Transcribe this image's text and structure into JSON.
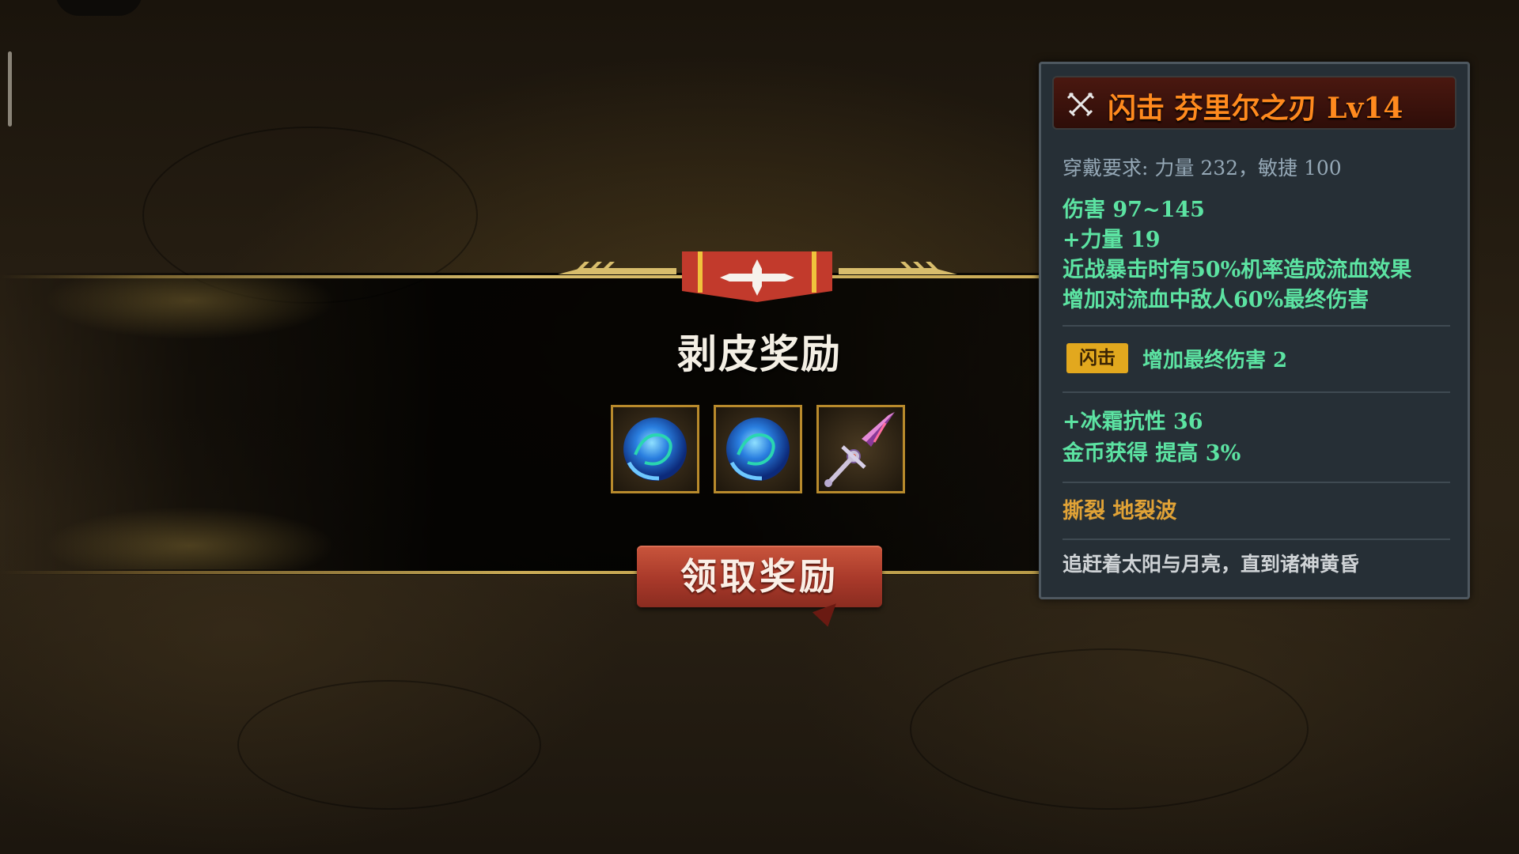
{
  "reward_dialog": {
    "title": "剥皮奖励",
    "rewards": [
      {
        "icon": "blue-orb-icon"
      },
      {
        "icon": "blue-orb-icon"
      },
      {
        "icon": "sword-icon"
      }
    ],
    "claim_button": "领取奖励"
  },
  "item_tooltip": {
    "header_icon": "crossed-swords-icon",
    "name": "闪击 芬里尔之刃 Lv14",
    "requirement": "穿戴要求:  力量 232，敏捷 100",
    "base_stats": [
      "伤害  97~145",
      "+力量 19",
      "近战暴击时有50%机率造成流血效果",
      "增加对流血中敌人60%最终伤害"
    ],
    "skill_tag": "闪击",
    "skill_bonus": "增加最终伤害 2",
    "extra_stats": [
      "+冰霜抗性  36",
      "金币获得  提高  3%"
    ],
    "passives": "撕裂   地裂波",
    "flavor_text": "追赶着太阳与月亮，直到诸神黄昏"
  },
  "colors": {
    "item_name": "#ff8a1e",
    "stat_green": "#5ce3a2",
    "passive_gold": "#e0a236",
    "skill_tag_bg": "#e2a81e",
    "button_red": "#a8392a"
  }
}
